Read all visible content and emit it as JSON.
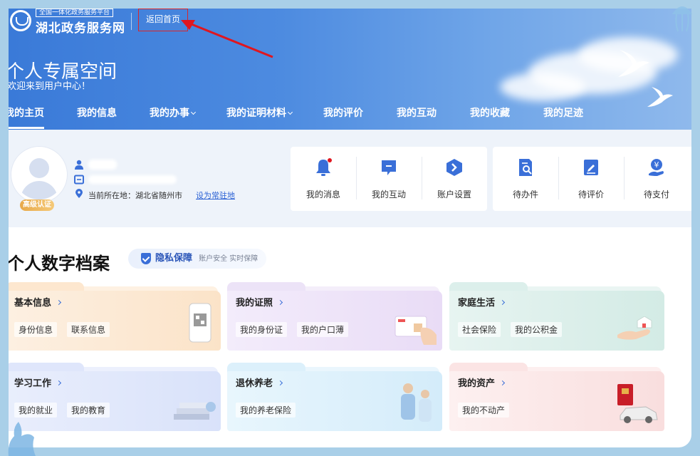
{
  "header": {
    "logo_sub": "全国一体化政务服务平台",
    "logo_title": "湖北政务服务网",
    "back_home": "返回首页",
    "space_title": "个人专属空间",
    "space_subtitle": "欢迎来到用户中心！"
  },
  "nav": {
    "items": [
      {
        "label": "我的主页",
        "dropdown": false,
        "active": true
      },
      {
        "label": "我的信息",
        "dropdown": false
      },
      {
        "label": "我的办事",
        "dropdown": true
      },
      {
        "label": "我的证明材料",
        "dropdown": true
      },
      {
        "label": "我的评价",
        "dropdown": false
      },
      {
        "label": "我的互动",
        "dropdown": false
      },
      {
        "label": "我的收藏",
        "dropdown": false
      },
      {
        "label": "我的足迹",
        "dropdown": false
      }
    ]
  },
  "profile": {
    "cert_badge": "高级认证",
    "location_label": "当前所在地：湖北省随州市",
    "set_residence": "设为常驻地"
  },
  "quick_left": [
    {
      "label": "我的消息",
      "icon": "bell-icon"
    },
    {
      "label": "我的互动",
      "icon": "chat-icon"
    },
    {
      "label": "账户设置",
      "icon": "settings-hex-icon"
    }
  ],
  "quick_right": [
    {
      "label": "待办件",
      "icon": "doc-search-icon"
    },
    {
      "label": "待评价",
      "icon": "edit-icon"
    },
    {
      "label": "待支付",
      "icon": "payment-icon"
    }
  ],
  "archive": {
    "title": "个人数字档案",
    "privacy_title": "隐私保障",
    "privacy_desc": "账户安全 实时保障",
    "categories": [
      {
        "title": "基本信息",
        "tags": [
          "身份信息",
          "联系信息"
        ]
      },
      {
        "title": "我的证照",
        "tags": [
          "我的身份证",
          "我的户口薄"
        ]
      },
      {
        "title": "家庭生活",
        "tags": [
          "社会保险",
          "我的公积金"
        ]
      },
      {
        "title": "学习工作",
        "tags": [
          "我的就业",
          "我的教育"
        ]
      },
      {
        "title": "退休养老",
        "tags": [
          "我的养老保险"
        ]
      },
      {
        "title": "我的资产",
        "tags": [
          "我的不动产"
        ]
      }
    ]
  },
  "colors": {
    "primary": "#3a7ad8",
    "accent_red": "#d8262c",
    "link": "#2f64d5"
  }
}
